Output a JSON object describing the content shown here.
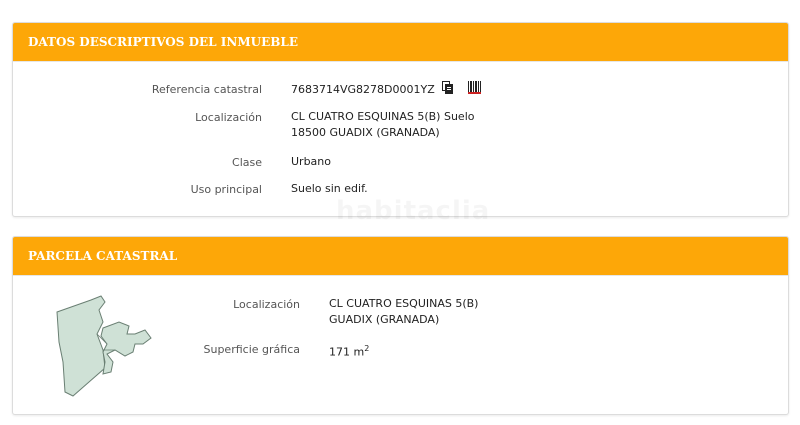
{
  "inmueble": {
    "title": "DATOS DESCRIPTIVOS DEL INMUEBLE",
    "rows": [
      {
        "label": "Referencia catastral",
        "value": "7683714VG8278D0001YZ"
      },
      {
        "label": "Localización",
        "value_line1": "CL CUATRO ESQUINAS 5(B) Suelo",
        "value_line2": "18500 GUADIX (GRANADA)"
      },
      {
        "label": "Clase",
        "value": "Urbano"
      },
      {
        "label": "Uso principal",
        "value": "Suelo sin edif."
      }
    ],
    "icons": [
      "copy-icon",
      "barcode-icon"
    ]
  },
  "watermark": "habitaclia",
  "parcela": {
    "title": "PARCELA CATASTRAL",
    "rows": [
      {
        "label": "Localización",
        "value_line1": "CL CUATRO ESQUINAS 5(B)",
        "value_line2": "GUADIX (GRANADA)"
      },
      {
        "label": "Superficie gráfica",
        "value": "171 m",
        "unit_sup": "2"
      }
    ],
    "map_colors": {
      "fill": "#cfe1d6",
      "stroke": "#6a7f73"
    }
  },
  "colors": {
    "accent": "#fda708"
  }
}
